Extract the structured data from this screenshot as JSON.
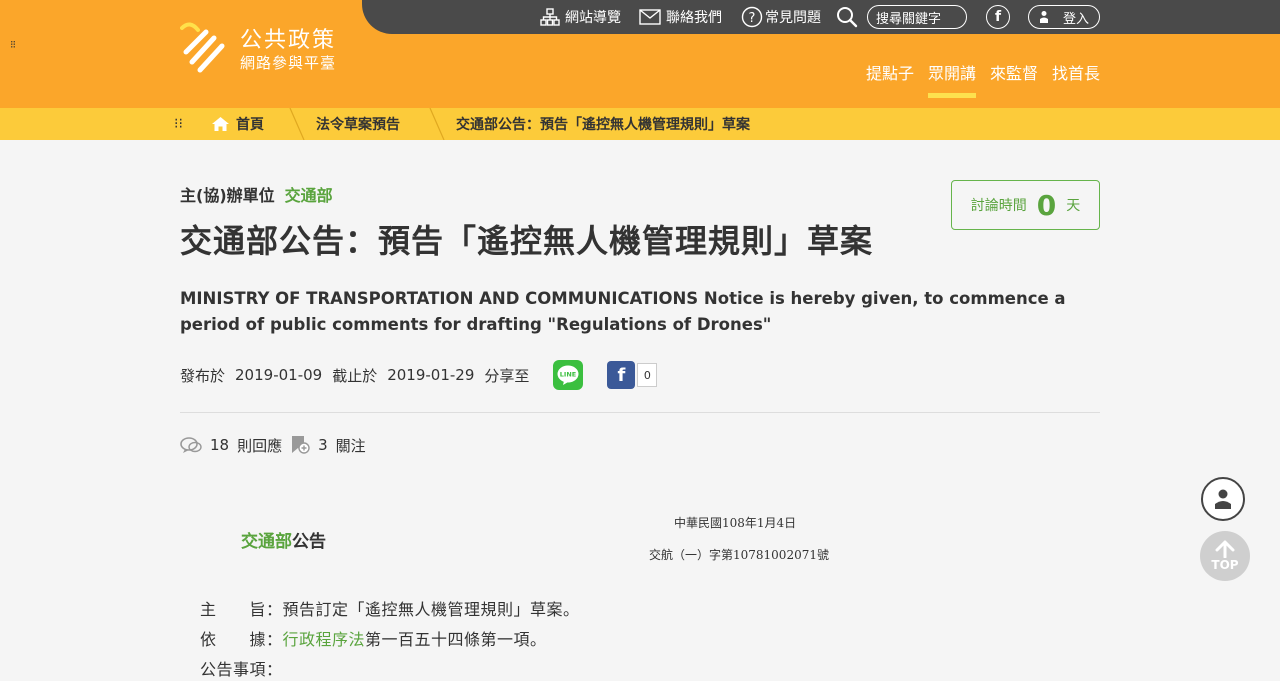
{
  "site": {
    "logo_title": "公共政策",
    "logo_sub": "網路參與平臺"
  },
  "topnav": {
    "sitemap": "網站導覽",
    "contact": "聯絡我們",
    "faq": "常見問題",
    "search_placeholder": "搜尋關鍵字",
    "login": "登入"
  },
  "mainnav": {
    "tabs": [
      {
        "label": "提點子"
      },
      {
        "label": "眾開講"
      },
      {
        "label": "來監督"
      },
      {
        "label": "找首長"
      }
    ],
    "active_index": 1
  },
  "breadcrumb": {
    "home": "首頁",
    "level1": "法令草案預告",
    "level2": "交通部公告：預告「遙控無人機管理規則」草案"
  },
  "article": {
    "org_label": "主(協)辦單位",
    "org_name": "交通部",
    "title": "交通部公告：預告「遙控無人機管理規則」草案",
    "discussion_label": "討論時間",
    "discussion_days": "0",
    "discussion_unit": "天",
    "english_title": "MINISTRY OF TRANSPORTATION AND COMMUNICATIONS Notice is hereby given, to commence a period of public comments for drafting \"Regulations of Drones\"",
    "published_label": "發布於",
    "published_date": "2019-01-09",
    "deadline_label": "截止於",
    "deadline_date": "2019-01-29",
    "share_label": "分享至",
    "fb_count": "0",
    "reply_count": "18",
    "reply_label": "則回應",
    "follow_count": "3",
    "follow_label": "關注"
  },
  "document": {
    "head_org": "交通部",
    "head_suffix": "公告",
    "date": "中華民國108年1月4日",
    "ref": "交航（一）字第10781002071號",
    "subject_label": "主　　旨：",
    "subject_text": "預告訂定「遙控無人機管理規則」草案。",
    "basis_label": "依　　據：",
    "basis_link": "行政程序法",
    "basis_text": "第一百五十四條第一項。",
    "notice_label": "公告事項："
  },
  "floating": {
    "top_label": "TOP"
  },
  "colors": {
    "header": "#fba62a",
    "breadcrumb": "#fccb3a",
    "accent_green": "#5aa43e"
  }
}
